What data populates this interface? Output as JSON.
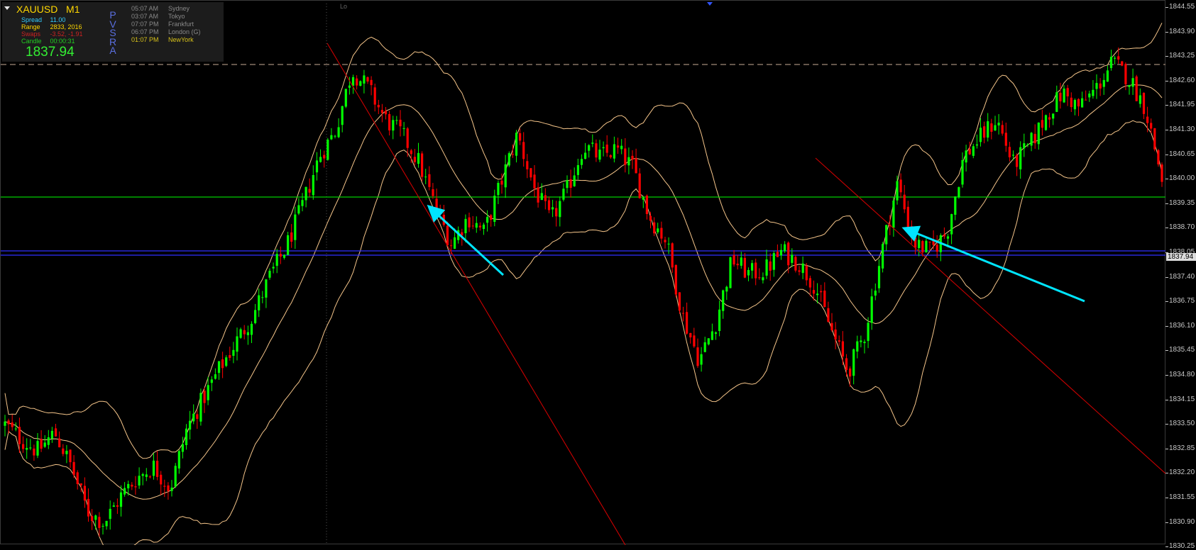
{
  "panel": {
    "symbol": "XAUUSD",
    "timeframe": "M1",
    "spread_label": "Spread",
    "spread_value": "11.00",
    "range_label": "Range",
    "range_value": "2833, 2016",
    "swaps_label": "Swaps",
    "swaps_value": "-3.52, -1.91",
    "candle_label": "Candle",
    "candle_value": "00:00:31",
    "price": "1837.94",
    "pvsra_letters": [
      "P",
      "V",
      "S",
      "R",
      "A"
    ],
    "sessions": [
      {
        "time": "05:07 AM",
        "name": "Sydney",
        "color": "#8a8a8a"
      },
      {
        "time": "03:07 AM",
        "name": "Tokyo",
        "color": "#8a8a8a"
      },
      {
        "time": "07:07 PM",
        "name": "Frankfurt",
        "color": "#8a8a8a"
      },
      {
        "time": "06:07 PM",
        "name": "London  (G)",
        "color": "#8a8a8a"
      },
      {
        "time": "01:07 PM",
        "name": "NewYork",
        "color": "#d8c21a"
      }
    ]
  },
  "chart_labels": {
    "lo_label": "Lo"
  },
  "price_axis": {
    "labels": [
      "1844.55",
      "1843.90",
      "1843.25",
      "1842.60",
      "1841.95",
      "1841.30",
      "1840.65",
      "1840.00",
      "1839.35",
      "1838.70",
      "1838.05",
      "1837.40",
      "1836.75",
      "1836.10",
      "1835.45",
      "1834.80",
      "1834.15",
      "1833.50",
      "1832.85",
      "1832.20",
      "1831.55",
      "1830.90",
      "1830.25"
    ],
    "current_price": "1837.94"
  },
  "colors": {
    "bull": "#00ff00",
    "bear": "#ff0000",
    "band": "#f5c58a",
    "support_line": "#00cc00",
    "price_line": "#3030ff",
    "trendline": "#cc0000",
    "arrow": "#00e5ff",
    "dashed_level": "#a08a78"
  },
  "chart_data": {
    "type": "candlestick",
    "symbol": "XAUUSD",
    "timeframe": "M1",
    "ylim": [
      1830.25,
      1844.55
    ],
    "last_price": 1837.94,
    "close_path": [
      1833.5,
      1833.1,
      1832.8,
      1833.3,
      1832.4,
      1831.2,
      1830.9,
      1831.6,
      1832.1,
      1832.4,
      1831.8,
      1833.4,
      1834.2,
      1835.0,
      1835.7,
      1836.4,
      1837.4,
      1838.2,
      1839.3,
      1840.6,
      1841.3,
      1842.9,
      1842.4,
      1841.6,
      1841.2,
      1840.5,
      1839.3,
      1838.3,
      1839.0,
      1838.6,
      1839.9,
      1841.2,
      1839.8,
      1838.9,
      1839.7,
      1840.9,
      1840.6,
      1840.8,
      1840.3,
      1839.0,
      1838.4,
      1836.4,
      1835.2,
      1836.2,
      1837.9,
      1837.5,
      1837.6,
      1838.1,
      1837.8,
      1837.2,
      1836.0,
      1834.9,
      1835.9,
      1838.0,
      1839.9,
      1838.3,
      1838.1,
      1838.6,
      1840.6,
      1841.1,
      1841.6,
      1840.4,
      1840.9,
      1841.7,
      1842.3,
      1841.9,
      1842.4,
      1843.1,
      1842.7,
      1841.9,
      1840.0
    ]
  }
}
